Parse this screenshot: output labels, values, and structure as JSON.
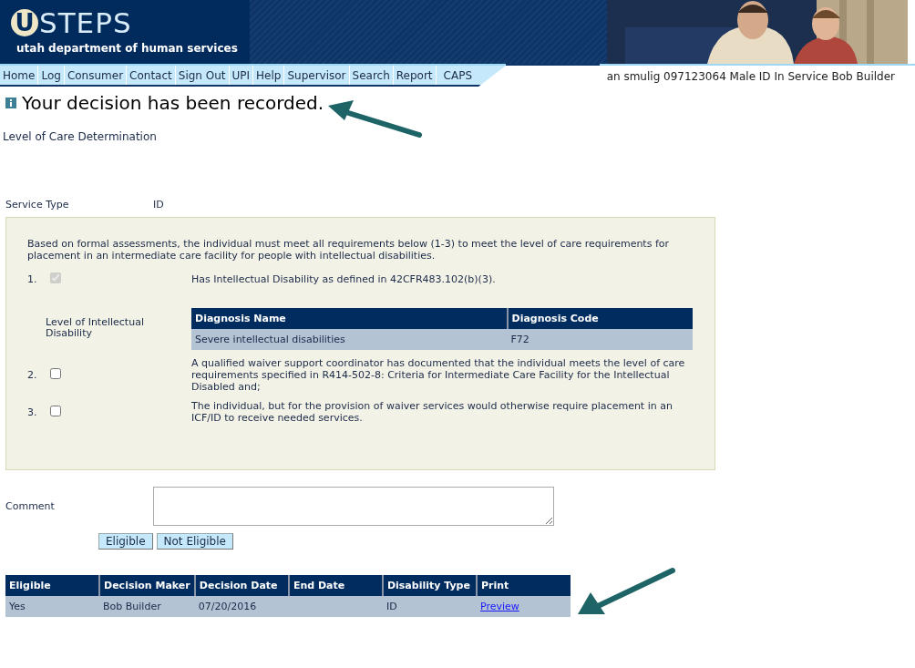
{
  "header": {
    "logo_mark": "U",
    "logo_text": "STEPS",
    "subtitle": "utah department of human services"
  },
  "nav": {
    "items": [
      {
        "label": "Home"
      },
      {
        "label": "Log"
      },
      {
        "label": "Consumer"
      },
      {
        "label": "Contact"
      },
      {
        "label": "Sign Out"
      },
      {
        "label": "UPI"
      },
      {
        "label": "Help"
      },
      {
        "label": "Supervisor"
      },
      {
        "label": "Search"
      },
      {
        "label": "Report"
      },
      {
        "label": "CAPS"
      }
    ],
    "user_info": "an smulig 097123064 Male ID In Service Bob Builder"
  },
  "message": "Your decision has been recorded.",
  "page_title": "Level of Care Determination",
  "service_type": {
    "label": "Service Type",
    "value": "ID"
  },
  "criteria": {
    "intro": "Based on formal assessments, the individual must meet all requirements below (1-3) to meet the level of care requirements for placement in an intermediate care facility for people with intellectual disabilities.",
    "items": [
      {
        "kind": "requirement",
        "number": "1.",
        "checked": true,
        "disabled": true,
        "text": "Has Intellectual Disability as defined in 42CFR483.102(b)(3)."
      },
      {
        "kind": "diagnosis",
        "label": "Level of Intellectual Disability",
        "columns": [
          "Diagnosis Name",
          "Diagnosis Code"
        ],
        "rows": [
          [
            "Severe intellectual disabilities",
            "F72"
          ]
        ]
      },
      {
        "kind": "requirement",
        "number": "2.",
        "checked": false,
        "disabled": false,
        "text": "A qualified waiver support coordinator has documented that the individual meets the level of care requirements specified in R414-502-8: Criteria for Intermediate Care Facility for the Intellectual Disabled and;"
      },
      {
        "kind": "requirement",
        "number": "3.",
        "checked": false,
        "disabled": false,
        "text": "The individual, but for the provision of waiver services would otherwise require placement in an ICF/ID to receive needed services."
      }
    ]
  },
  "comment": {
    "label": "Comment"
  },
  "buttons": [
    "Eligible",
    "Not Eligible"
  ],
  "decisions": {
    "columns": [
      "Eligible",
      "Decision Maker",
      "Decision Date",
      "End Date",
      "Disability Type",
      "Print"
    ],
    "rows": [
      [
        {
          "kind": "text",
          "text": "Yes"
        },
        {
          "kind": "text",
          "text": "Bob Builder"
        },
        {
          "kind": "text",
          "text": "07/20/2016"
        },
        {
          "kind": "empty"
        },
        {
          "kind": "text",
          "text": "ID"
        },
        {
          "kind": "link",
          "text": "Preview"
        }
      ]
    ]
  }
}
